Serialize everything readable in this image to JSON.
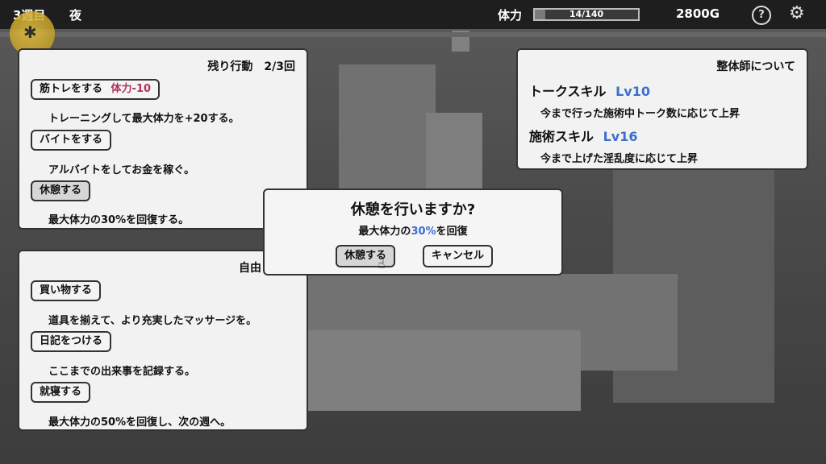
{
  "hud": {
    "week": "3週目",
    "time_of_day": "夜",
    "hp_label": "体力",
    "hp_text": "14/140",
    "hp_fraction": 0.1,
    "money": "2800G",
    "help_icon": "question-icon",
    "settings_icon": "gear-icon",
    "avatar_icon": "spider-icon"
  },
  "actions_panel": {
    "remaining": "残り行動　2/3回",
    "items": [
      {
        "label": "筋トレをする",
        "cost": "体力-10",
        "desc": "トレーニングして最大体力を+20する。"
      },
      {
        "label": "バイトをする",
        "cost": "",
        "desc": "アルバイトをしてお金を稼ぐ。"
      },
      {
        "label": "休憩する",
        "cost": "",
        "desc": "最大体力の30%を回復する。"
      }
    ]
  },
  "free_panel": {
    "title": "自由",
    "items": [
      {
        "label": "買い物する",
        "desc": "道具を揃えて、より充実したマッサージを。"
      },
      {
        "label": "日記をつける",
        "desc": "ここまでの出来事を記録する。"
      },
      {
        "label": "就寝する",
        "desc": "最大体力の50%を回復し、次の週へ。"
      }
    ]
  },
  "info_panel": {
    "title": "整体師について",
    "skills": [
      {
        "name": "トークスキル",
        "level": "Lv10",
        "desc": "今まで行った施術中トーク数に応じて上昇"
      },
      {
        "name": "施術スキル",
        "level": "Lv16",
        "desc": "今まで上げた淫乱度に応じて上昇"
      }
    ]
  },
  "dialog": {
    "title": "休憩を行いますか?",
    "sub_prefix": "最大体力の",
    "sub_value": "30%",
    "sub_suffix": "を回復",
    "confirm": "休憩する",
    "cancel": "キャンセル"
  },
  "colors": {
    "accent_pink": "#b0335a",
    "accent_blue": "#3c6fd0"
  }
}
